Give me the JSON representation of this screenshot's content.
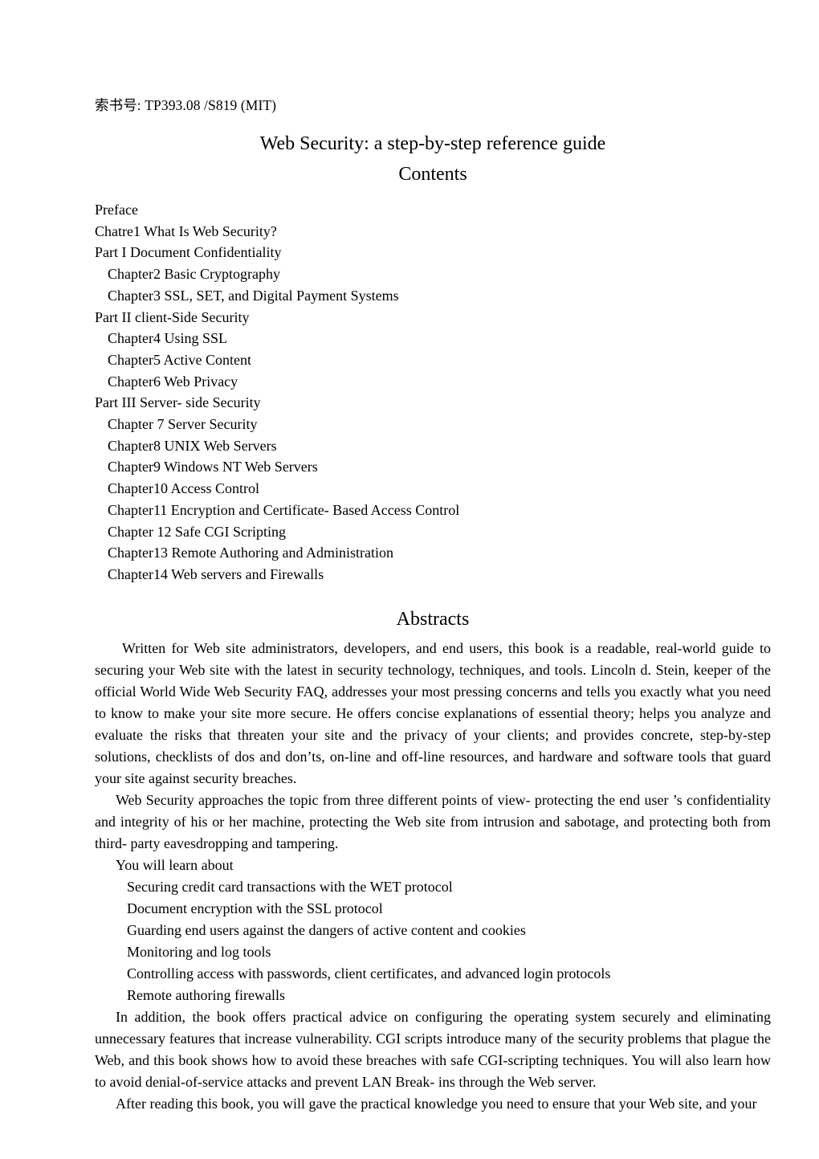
{
  "document": {
    "call_number_line": "索书号: TP393.08 /S819 (MIT)",
    "title": "Web Security: a step-by-step reference guide",
    "contents_heading": "Contents",
    "abstracts_heading": "Abstracts"
  },
  "contents": {
    "entries": [
      {
        "text": "Preface",
        "level": 1
      },
      {
        "text": "Chatre1 What Is Web Security?",
        "level": 1
      },
      {
        "text": "Part I Document Confidentiality",
        "level": 1
      },
      {
        "text": "Chapter2 Basic Cryptography",
        "level": 2
      },
      {
        "text": "Chapter3 SSL, SET, and Digital Payment Systems",
        "level": 2
      },
      {
        "text": "Part II client-Side Security",
        "level": 1
      },
      {
        "text": "Chapter4 Using SSL",
        "level": 2
      },
      {
        "text": "Chapter5 Active Content",
        "level": 2
      },
      {
        "text": "Chapter6 Web Privacy",
        "level": 2
      },
      {
        "text": "Part III Server- side Security",
        "level": 1
      },
      {
        "text": "Chapter 7 Server Security",
        "level": 2
      },
      {
        "text": "Chapter8 UNIX Web Servers",
        "level": 2
      },
      {
        "text": "Chapter9 Windows NT Web Servers",
        "level": 2
      },
      {
        "text": "Chapter10 Access Control",
        "level": 2
      },
      {
        "text": "Chapter11 Encryption and Certificate- Based Access Control",
        "level": 2
      },
      {
        "text": "Chapter 12 Safe CGI Scripting",
        "level": 2
      },
      {
        "text": "Chapter13 Remote Authoring and Administration",
        "level": 2
      },
      {
        "text": "Chapter14 Web servers and Firewalls",
        "level": 2
      }
    ]
  },
  "abstracts": {
    "paragraph_1": "Written for Web site administrators, developers, and end users, this book is a readable, real-world guide to securing your Web site with the latest in security technology, techniques, and tools. Lincoln d. Stein, keeper of the official World Wide Web Security FAQ, addresses your most pressing concerns and tells you exactly what you need to know to make your site more secure. He offers concise explanations of essential theory; helps you analyze and evaluate the risks that threaten your site and the privacy of your clients; and provides concrete, step-by-step solutions, checklists of dos and don’ts, on-line and off-line  resources, and hardware and software tools that guard your site against security breaches.",
    "paragraph_2": "Web Security approaches the topic from three different points of view- protecting the end user ’s confidentiality and integrity of his or her machine, protecting the Web site from intrusion and sabotage, and protecting both from third- party eavesdropping and tampering.",
    "learn_lead": "You will learn about",
    "learn_items": [
      "Securing credit card transactions with the WET protocol",
      "Document encryption with the SSL protocol",
      "Guarding end users against the dangers of active content and cookies",
      "Monitoring and log tools",
      "Controlling access with passwords, client certificates, and advanced login protocols",
      "Remote authoring firewalls"
    ],
    "paragraph_3": "In addition, the book offers practical advice on configuring the operating system securely and eliminating unnecessary features that increase vulnerability. CGI scripts introduce many of the security problems that plague the Web, and this book shows how to avoid these breaches with safe CGI-scripting techniques. You will also learn how to avoid denial-of-service attacks and prevent LAN Break- ins through the Web server.",
    "paragraph_4": "After reading this book, you will gave the practical knowledge you need to ensure that your Web site, and your"
  }
}
